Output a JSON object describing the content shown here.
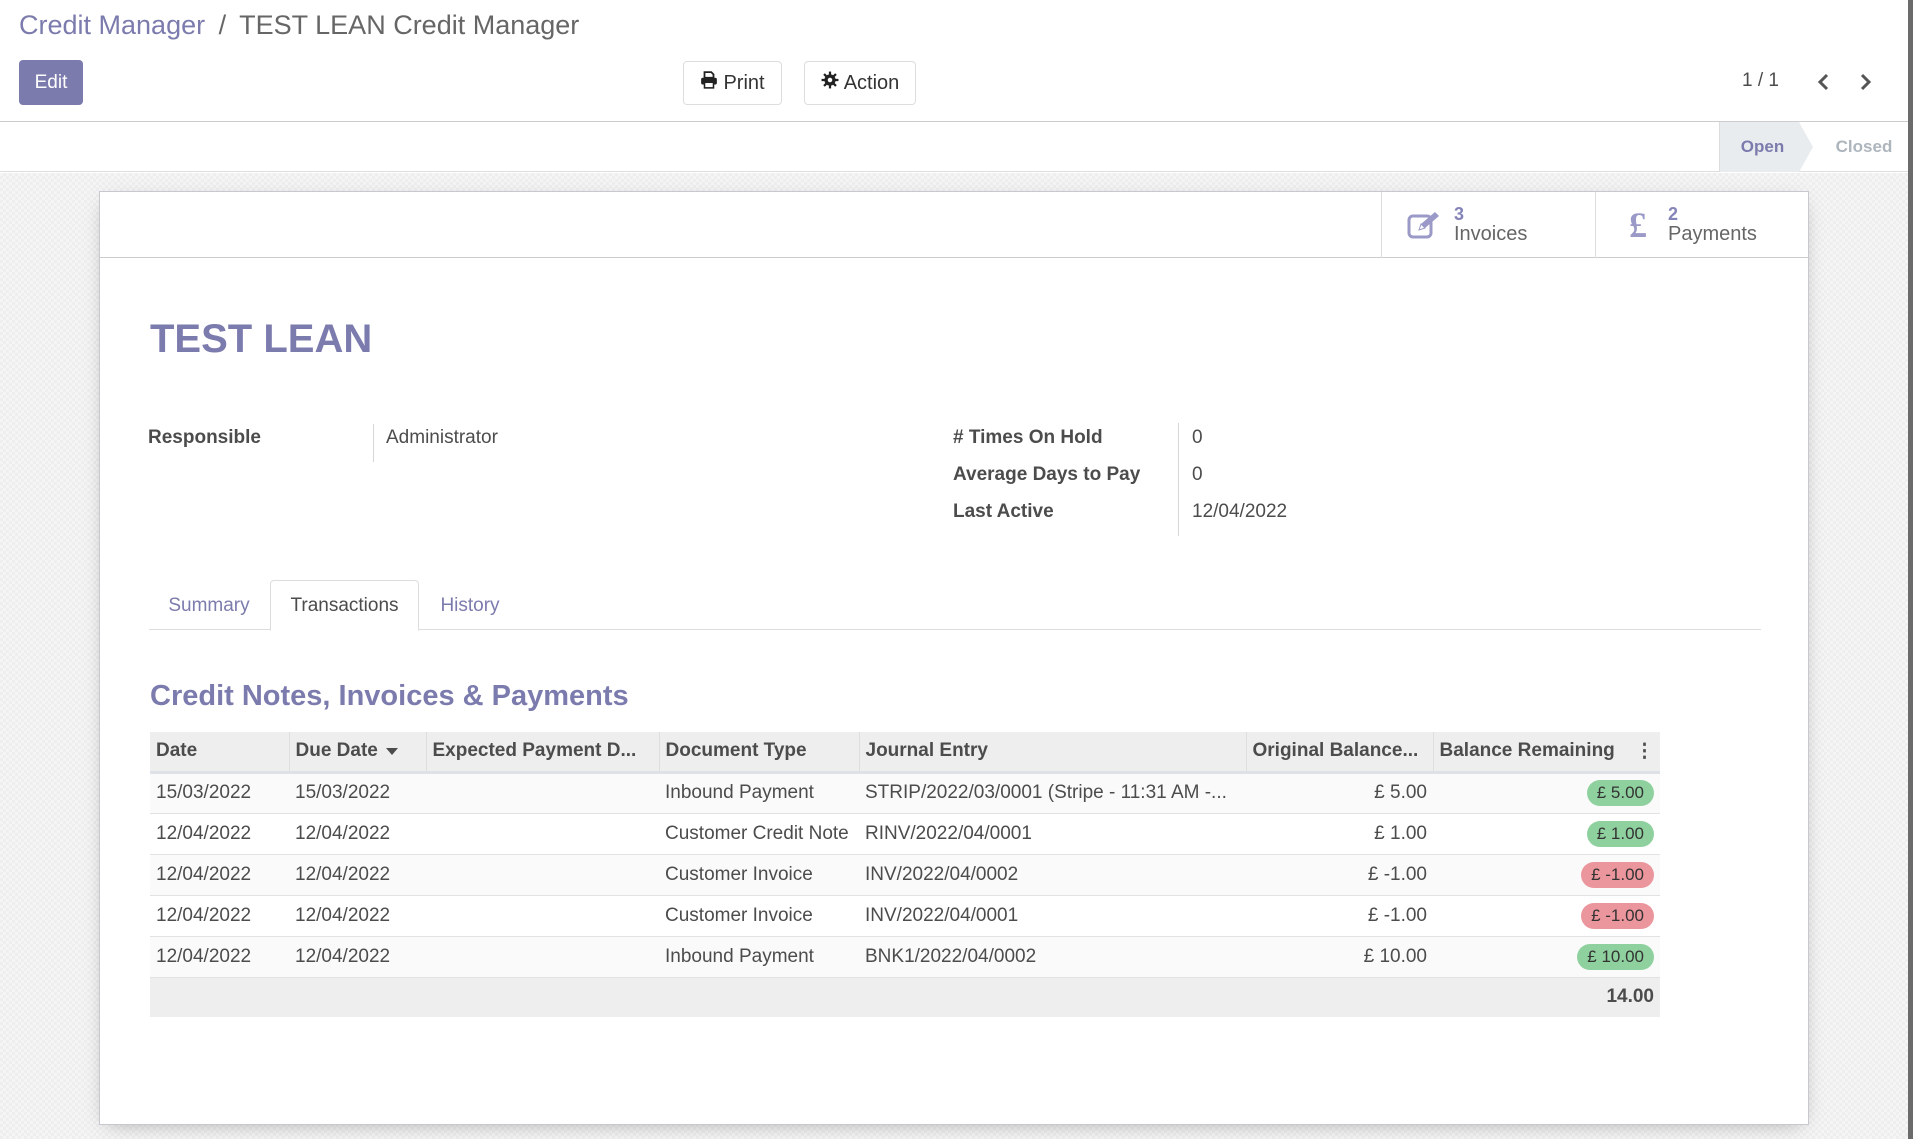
{
  "breadcrumb": {
    "parent": "Credit Manager",
    "separator": "/",
    "current": "TEST LEAN Credit Manager"
  },
  "toolbar": {
    "edit_label": "Edit",
    "print_label": "Print",
    "action_label": "Action"
  },
  "pager": {
    "value": "1 / 1"
  },
  "status": {
    "stages": [
      "Open",
      "Closed"
    ],
    "active": "Open"
  },
  "stat_buttons": {
    "invoices": {
      "value": "3",
      "label": "Invoices",
      "icon": "pencil-square-icon"
    },
    "payments": {
      "value": "2",
      "label": "Payments",
      "icon": "pound-sign-icon"
    }
  },
  "record": {
    "title": "TEST LEAN",
    "fields": {
      "responsible": {
        "label": "Responsible",
        "value": "Administrator"
      },
      "times_on_hold": {
        "label": "# Times On Hold",
        "value": "0"
      },
      "avg_days_to_pay": {
        "label": "Average Days to Pay",
        "value": "0"
      },
      "last_active": {
        "label": "Last Active",
        "value": "12/04/2022"
      }
    }
  },
  "tabs": [
    {
      "label": "Summary",
      "active": false
    },
    {
      "label": "Transactions",
      "active": true
    },
    {
      "label": "History",
      "active": false
    }
  ],
  "section": {
    "title": "Credit Notes, Invoices & Payments"
  },
  "table": {
    "columns": [
      "Date",
      "Due Date",
      "Expected Payment D...",
      "Document Type",
      "Journal Entry",
      "Original Balance...",
      "Balance Remaining"
    ],
    "sorted_column": "Due Date",
    "rows": [
      {
        "date": "15/03/2022",
        "due_date": "15/03/2022",
        "expected": "",
        "doc_type": "Inbound Payment",
        "journal": "STRIP/2022/03/0001 (Stripe - 11:31 AM -...",
        "original": "£ 5.00",
        "remaining": "£ 5.00",
        "status": "positive"
      },
      {
        "date": "12/04/2022",
        "due_date": "12/04/2022",
        "expected": "",
        "doc_type": "Customer Credit Note",
        "journal": "RINV/2022/04/0001",
        "original": "£ 1.00",
        "remaining": "£ 1.00",
        "status": "positive"
      },
      {
        "date": "12/04/2022",
        "due_date": "12/04/2022",
        "expected": "",
        "doc_type": "Customer Invoice",
        "journal": "INV/2022/04/0002",
        "original": "£ -1.00",
        "remaining": "£ -1.00",
        "status": "negative"
      },
      {
        "date": "12/04/2022",
        "due_date": "12/04/2022",
        "expected": "",
        "doc_type": "Customer Invoice",
        "journal": "INV/2022/04/0001",
        "original": "£ -1.00",
        "remaining": "£ -1.00",
        "status": "negative"
      },
      {
        "date": "12/04/2022",
        "due_date": "12/04/2022",
        "expected": "",
        "doc_type": "Inbound Payment",
        "journal": "BNK1/2022/04/0002",
        "original": "£ 10.00",
        "remaining": "£ 10.00",
        "status": "positive"
      }
    ],
    "total": "14.00"
  },
  "colors": {
    "brand": "#7c7bad",
    "positive_badge": "#8fd19e",
    "negative_badge": "#eb959c"
  }
}
